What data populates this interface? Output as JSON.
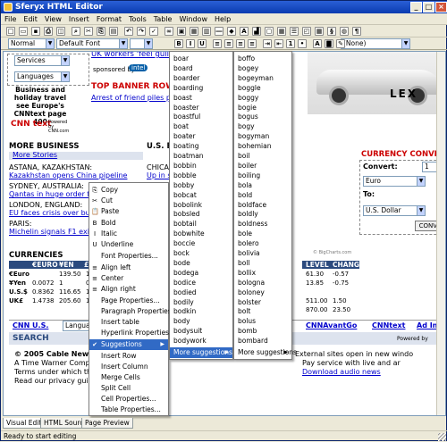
{
  "window": {
    "title": "Sferyx HTML Editor",
    "minimize": "_",
    "maximize": "□",
    "close": "×"
  },
  "menubar": [
    "File",
    "Edit",
    "View",
    "Insert",
    "Format",
    "Tools",
    "Table",
    "Window",
    "Help"
  ],
  "toolbar2": {
    "style": "Normal",
    "font": "Default Font",
    "size": "",
    "color_combo": "(None)"
  },
  "doc": {
    "services": "Services",
    "languages": "Languages",
    "headline_link": "UK workers 'feel guilty' at",
    "sponsored": "sponsored by",
    "sponsor_logo": "intel",
    "ad_text": "Business and holiday travel see Europe's CNNtext page 400",
    "cnn_logo": "CNN text",
    "cnn_powered": "Powered by CNN.com",
    "topbanner": "TOP BANNER ROW",
    "arrest_link": "Arrest of friend piles pres",
    "more_business": "MORE BUSINESS",
    "more_stories": "More Stories",
    "us_b": "U.S. B",
    "astana": "ASTANA, KAZAKHSTAN:",
    "astana_link": "Kazakhstan opens China pipeline",
    "chicago": "CHICAG",
    "up_in": "Up in s",
    "sydney": "SYDNEY, AUSTRALIA:",
    "sydney_link": "Qantas in huge order for Bo",
    "london": "LONDON, ENGLAND:",
    "london_link": "EU faces crisis over budget",
    "paris": "PARIS:",
    "paris_link": "Michelin signals F1 exit",
    "currencies": "CURRENCIES",
    "cur_headers": [
      "€EURO",
      "¥EN",
      "£"
    ],
    "cur_rows": [
      {
        "label": "€Euro",
        "a": "",
        "b": "139.50",
        "c": "1"
      },
      {
        "label": "¥Yen",
        "a": "0.0072",
        "b": "1",
        "c": "0.0"
      },
      {
        "label": "U.S.$",
        "a": "0.8362",
        "b": "116.65",
        "c": "1"
      },
      {
        "label": "UK£",
        "a": "1.4738",
        "b": "205.60",
        "c": "1"
      }
    ],
    "level": "LEVEL",
    "change": "CHANGE",
    "level_rows": [
      [
        "61.30",
        "-0.57"
      ],
      [
        "13.85",
        "-0.75"
      ]
    ],
    "level_rows2": [
      [
        "511.00",
        "1.50"
      ],
      [
        "870.00",
        "23.50"
      ]
    ],
    "bigcharts": "© BigCharts.com",
    "currency_converter": "CURRENCY CONVERTE",
    "convert": "Convert:",
    "convert_value": "1",
    "from_cur": "Euro",
    "to": "To:",
    "to_cur": "U.S. Dollar",
    "conv_btn": "CONVE",
    "cnn_us": "CNN U.S.",
    "lang_combo": "Languages",
    "cnnavantgo": "CNNAvantGo",
    "cnntext": "CNNtext",
    "ad_info": "Ad Info",
    "search": "SEARCH",
    "powered_by": "Powered by",
    "copyright": "© 2005 Cable News Netw",
    "timewarner": "A Time Warner Company",
    "terms": "Terms under which this s",
    "privacy": "Read our privacy guideline",
    "ext_sites": "External sites open in new windo",
    "payservice": "Pay service with live and ar",
    "download": "Download audio news",
    "lexus": "LEX"
  },
  "context_menu": [
    {
      "label": "Copy",
      "icon": "copy-icon",
      "glyph": "⎘"
    },
    {
      "label": "Cut",
      "icon": "cut-icon",
      "glyph": "✂"
    },
    {
      "label": "Paste",
      "icon": "paste-icon",
      "glyph": "📋"
    },
    {
      "label": "Bold",
      "icon": "bold-icon",
      "glyph": "B"
    },
    {
      "label": "Italic",
      "icon": "italic-icon",
      "glyph": "I"
    },
    {
      "label": "Underline",
      "icon": "underline-icon",
      "glyph": "U"
    },
    {
      "label": "Font Properties...",
      "icon": "",
      "glyph": ""
    },
    {
      "label": "Align left",
      "icon": "align-left-icon",
      "glyph": "≡"
    },
    {
      "label": "Center",
      "icon": "align-center-icon",
      "glyph": "≡"
    },
    {
      "label": "Align right",
      "icon": "align-right-icon",
      "glyph": "≡"
    },
    {
      "label": "Page Properties...",
      "icon": "",
      "glyph": ""
    },
    {
      "label": "Paragraph Properties...",
      "icon": "",
      "glyph": ""
    },
    {
      "label": "Insert table",
      "icon": "",
      "glyph": ""
    },
    {
      "label": "Hyperlink Properties...",
      "icon": "",
      "glyph": ""
    },
    {
      "label": "Suggestions",
      "icon": "spellcheck-icon",
      "glyph": "✔"
    },
    {
      "label": "Insert Row",
      "icon": "",
      "glyph": ""
    },
    {
      "label": "Insert Column",
      "icon": "",
      "glyph": ""
    },
    {
      "label": "Merge Cells",
      "icon": "",
      "glyph": ""
    },
    {
      "label": "Split Cell",
      "icon": "",
      "glyph": ""
    },
    {
      "label": "Cell Properties...",
      "icon": "",
      "glyph": ""
    },
    {
      "label": "Table Properties...",
      "icon": "",
      "glyph": ""
    }
  ],
  "suggestions1": [
    "boar",
    "board",
    "boarder",
    "boarding",
    "boast",
    "boaster",
    "boastful",
    "boat",
    "boater",
    "boating",
    "boatman",
    "bobbin",
    "bobble",
    "bobby",
    "bobcat",
    "bobolink",
    "bobsled",
    "bobtail",
    "bobwhite",
    "boccie",
    "bock",
    "bode",
    "bodega",
    "bodice",
    "bodied",
    "bodily",
    "bodkin",
    "body",
    "bodysuit",
    "bodywork"
  ],
  "more_suggestions_1": "More suggestions",
  "suggestions2": [
    "boffo",
    "bogey",
    "bogeyman",
    "boggle",
    "boggy",
    "bogie",
    "bogus",
    "bogy",
    "bogyman",
    "bohemian",
    "boil",
    "boiler",
    "boiling",
    "bola",
    "bold",
    "boldface",
    "boldly",
    "boldness",
    "bole",
    "bolero",
    "bolivia",
    "boll",
    "bollix",
    "bologna",
    "boloney",
    "bolster",
    "bolt",
    "bolus",
    "bomb",
    "bombard"
  ],
  "more_suggestions_2": "More suggestions",
  "tabs": [
    "Visual Editor",
    "HTML Source",
    "Page Preview"
  ],
  "status": "Ready to start editing"
}
